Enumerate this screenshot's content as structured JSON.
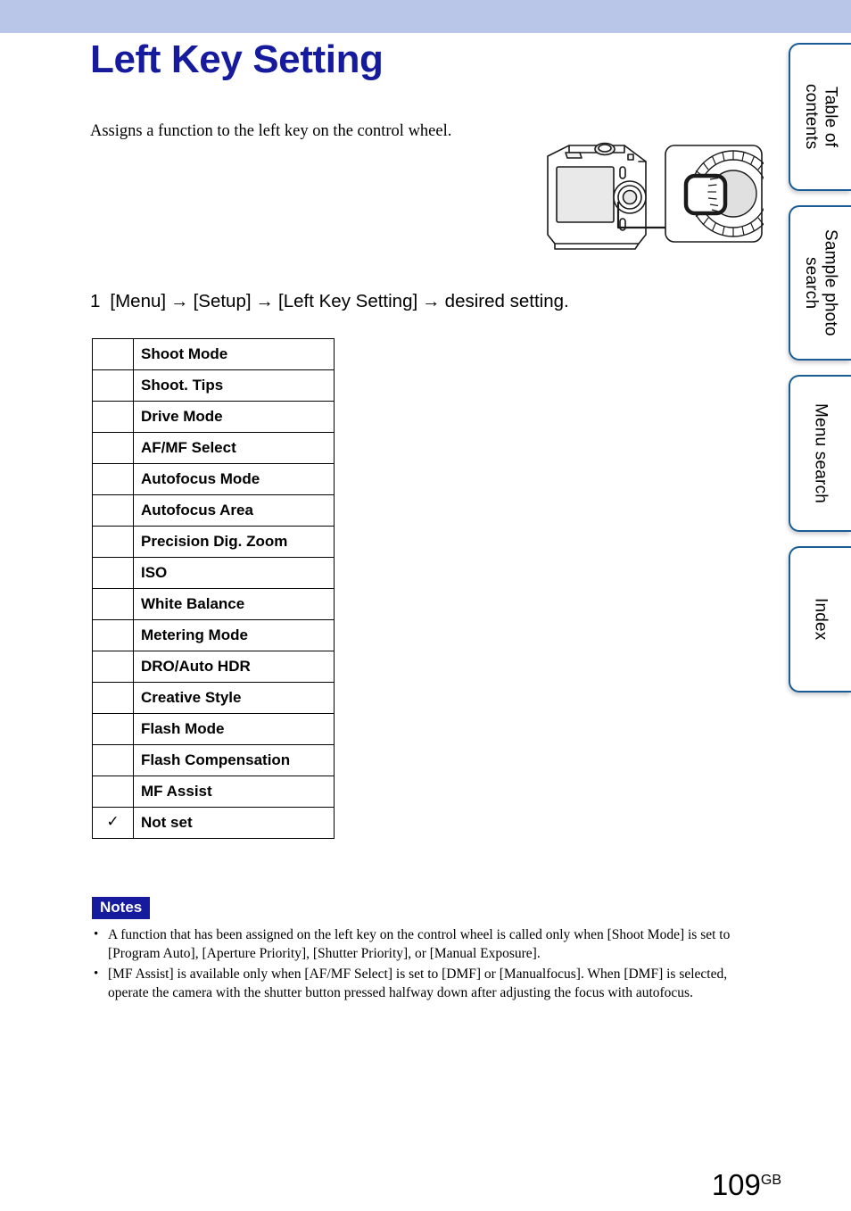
{
  "header": {
    "band_color": "#b9c6e8"
  },
  "page": {
    "title": "Left Key Setting",
    "intro": "Assigns a function to the left key on the control wheel.",
    "title_color": "#151b9c",
    "number": "109",
    "number_suffix": "GB"
  },
  "step": {
    "number": "1",
    "part1": "[Menu]",
    "arrow1": "→",
    "part2": "[Setup]",
    "arrow2": "→",
    "part3": "[Left Key Setting]",
    "arrow3": "→",
    "part4": "desired setting."
  },
  "illustration": {
    "name": "camera-rear-control-wheel-illustration",
    "caption": ""
  },
  "options_table": {
    "rows": [
      {
        "mark": "",
        "label": "Shoot Mode"
      },
      {
        "mark": "",
        "label": "Shoot. Tips"
      },
      {
        "mark": "",
        "label": "Drive Mode"
      },
      {
        "mark": "",
        "label": "AF/MF Select"
      },
      {
        "mark": "",
        "label": "Autofocus Mode"
      },
      {
        "mark": "",
        "label": "Autofocus Area"
      },
      {
        "mark": "",
        "label": "Precision Dig. Zoom"
      },
      {
        "mark": "",
        "label": "ISO"
      },
      {
        "mark": "",
        "label": "White Balance"
      },
      {
        "mark": "",
        "label": "Metering Mode"
      },
      {
        "mark": "",
        "label": "DRO/Auto HDR"
      },
      {
        "mark": "",
        "label": "Creative Style"
      },
      {
        "mark": "",
        "label": "Flash Mode"
      },
      {
        "mark": "",
        "label": "Flash Compensation"
      },
      {
        "mark": "",
        "label": "MF Assist"
      },
      {
        "mark": "✓",
        "label": "Not set"
      }
    ]
  },
  "notes": {
    "badge": "Notes",
    "badge_bg": "#151b9c",
    "items": [
      "A function that has been assigned on the left key on the control wheel is called only when [Shoot Mode] is set to [Program Auto], [Aperture Priority], [Shutter Priority], or [Manual Exposure].",
      "[MF Assist] is available only when [AF/MF Select] is set to [DMF] or [Manualfocus]. When [DMF] is selected, operate the camera with the shutter button pressed halfway down after adjusting the focus with autofocus."
    ],
    "bullet": "•"
  },
  "side_tabs": {
    "border_color": "#1b5c96",
    "items": [
      {
        "label": "Table of\ncontents"
      },
      {
        "label": "Sample photo\nsearch"
      },
      {
        "label": "Menu search"
      },
      {
        "label": "Index"
      }
    ]
  }
}
